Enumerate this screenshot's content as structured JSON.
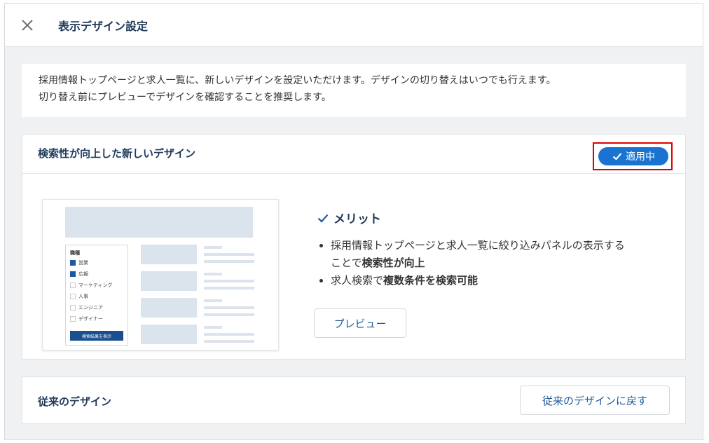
{
  "header": {
    "title": "表示デザイン設定",
    "close_icon": "close-icon"
  },
  "notice": {
    "line1": "採用情報トップページと求人一覧に、新しいデザインを設定いただけます。デザインの切り替えはいつでも行えます。",
    "line2": "切り替え前にプレビューでデザインを確認することを推奨します。"
  },
  "new_design": {
    "title": "検索性が向上した新しいデザイン",
    "status_badge": "適用中",
    "status_color": "#1a73d1",
    "highlight_color": "#e00000",
    "merit_title": "メリット",
    "bullet1_prefix": "採用情報トップページと求人一覧に絞り込みパネルの表示する",
    "bullet1_line2_pre": "ことで",
    "bullet1_bold": "検索性が向上",
    "bullet2_pre": "求人検索で",
    "bullet2_bold": "複数条件を検索可能",
    "preview_button": "プレビュー",
    "thumbnail": {
      "panel_title": "職種",
      "options": [
        {
          "label": "営業",
          "checked": true
        },
        {
          "label": "広報",
          "checked": true
        },
        {
          "label": "マーケティング",
          "checked": false
        },
        {
          "label": "人事",
          "checked": false
        },
        {
          "label": "エンジニア",
          "checked": false
        },
        {
          "label": "デザイナー",
          "checked": false
        }
      ],
      "search_button": "検索結果を表示"
    }
  },
  "old_design": {
    "title": "従来のデザイン",
    "revert_button": "従来のデザインに戻す"
  }
}
